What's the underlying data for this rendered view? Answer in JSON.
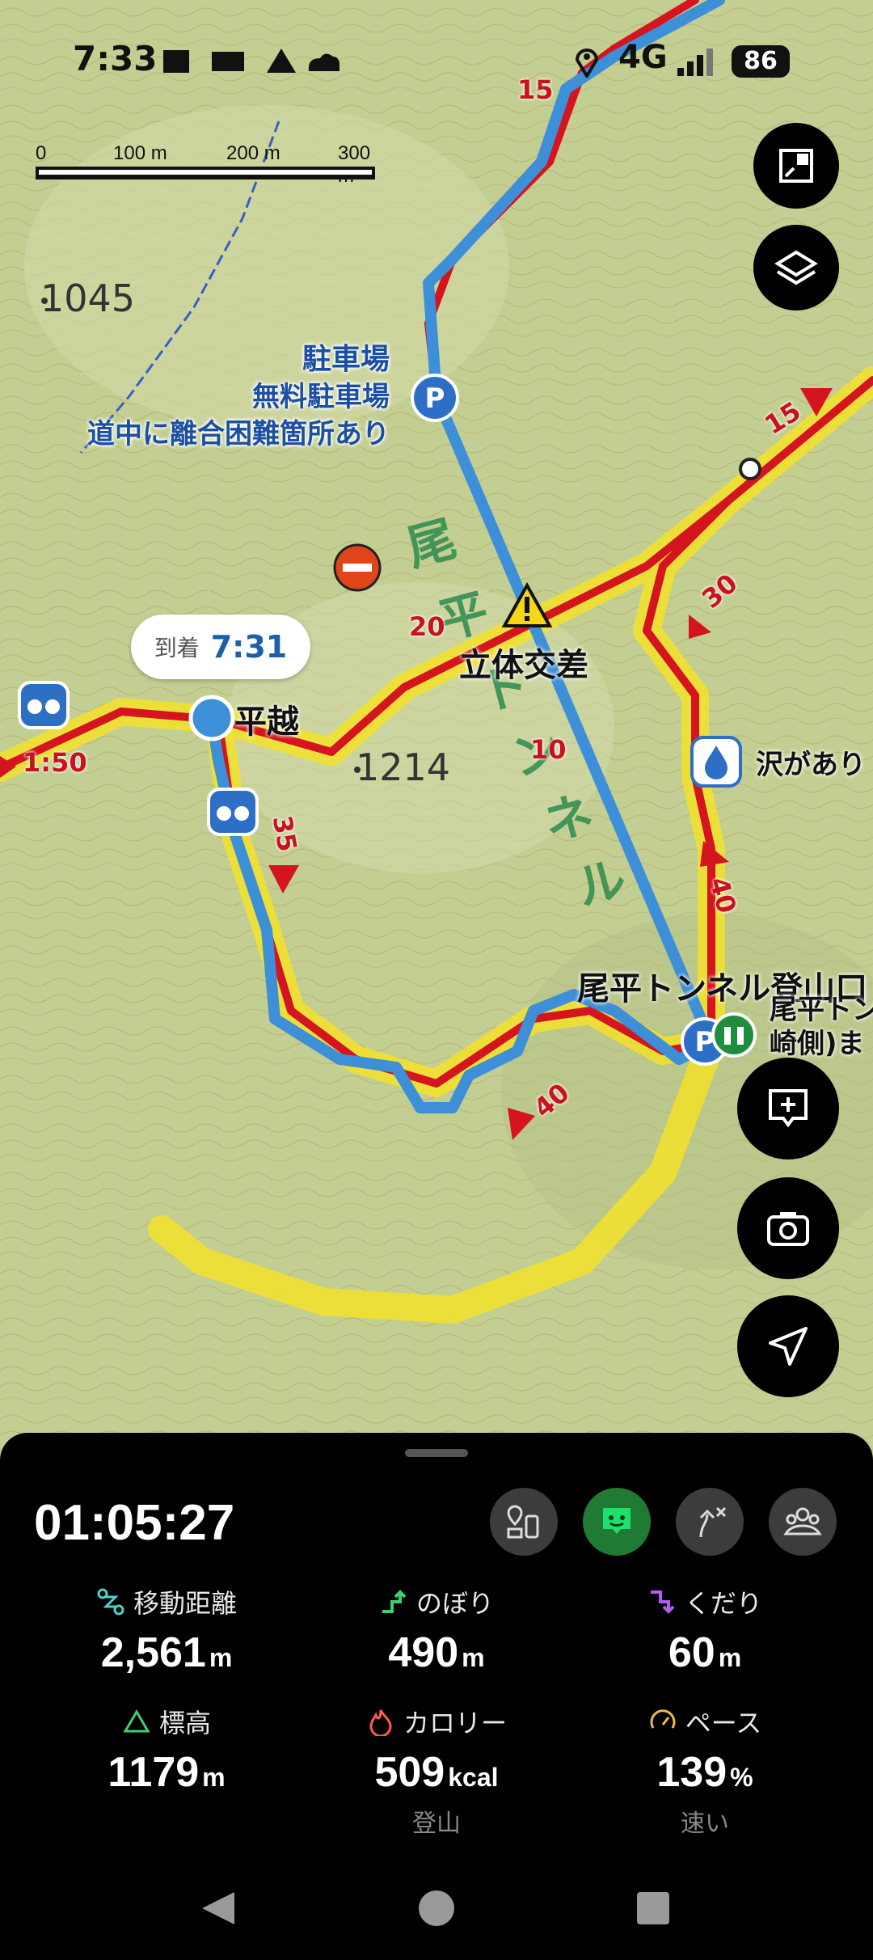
{
  "status_bar": {
    "time": "7:33",
    "network": "4G",
    "battery": "86"
  },
  "map": {
    "scale": {
      "labels": [
        "0",
        "100 m",
        "200 m",
        "300 m"
      ]
    },
    "elevations": [
      "1045",
      "1214"
    ],
    "parking_info": [
      "駐車場",
      "無料駐車場",
      "道中に離合困難箇所あり"
    ],
    "spot_hiragoe": "平越",
    "crossing": "立体交差",
    "trailhead": "尾平トンネル登山口",
    "trailhead_note_line1": "尾平トン",
    "trailhead_note_line2": "崎側)ま",
    "water": "沢があり",
    "tunnel_text": [
      "尾",
      "平",
      "ト",
      "ン",
      "ネ",
      "ル"
    ],
    "time_labels": [
      "15",
      "15",
      "20",
      "30",
      "10",
      "35",
      "40",
      "40",
      "1:50"
    ],
    "arrival": {
      "label": "到着",
      "time": "7:31"
    }
  },
  "panel": {
    "timer": "01:05:27",
    "stats": [
      {
        "label": "移動距離",
        "value": "2,561",
        "unit": "m",
        "icon": "route-icon",
        "sub": ""
      },
      {
        "label": "のぼり",
        "value": "490",
        "unit": "m",
        "icon": "ascent-icon",
        "sub": ""
      },
      {
        "label": "くだり",
        "value": "60",
        "unit": "m",
        "icon": "descent-icon",
        "sub": ""
      },
      {
        "label": "標高",
        "value": "1179",
        "unit": "m",
        "icon": "mountain-icon",
        "sub": ""
      },
      {
        "label": "カロリー",
        "value": "509",
        "unit": "kcal",
        "icon": "flame-icon",
        "sub": "登山"
      },
      {
        "label": "ペース",
        "value": "139",
        "unit": "%",
        "icon": "speedometer-icon",
        "sub": "速い"
      }
    ]
  },
  "colors": {
    "route_blue": "#3d8fd8",
    "trail_red": "#d4141e",
    "trail_yellow": "#f4e22a",
    "panel_bg": "#000000",
    "active_green": "#1e8e3e"
  }
}
